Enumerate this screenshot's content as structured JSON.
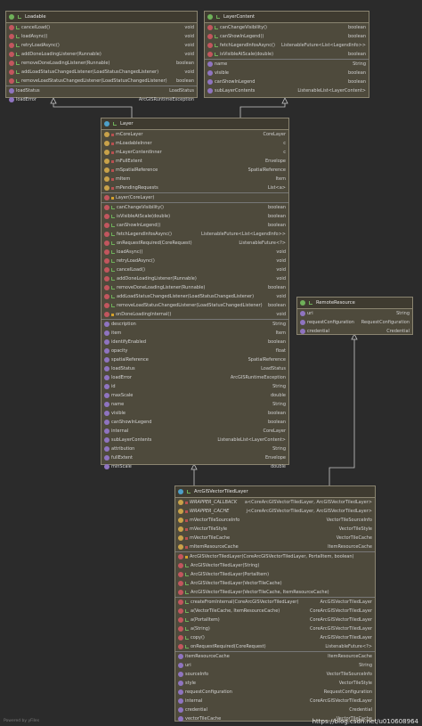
{
  "boxes": {
    "loadable": {
      "title": "Loadable",
      "kind": "interface",
      "sections": [
        [
          {
            "icon": "m",
            "vis": "pub",
            "name": "cancelLoad()",
            "type": "void"
          },
          {
            "icon": "m",
            "vis": "pub",
            "name": "loadAsync()",
            "type": "void"
          },
          {
            "icon": "m",
            "vis": "pub",
            "name": "retryLoadAsync()",
            "type": "void"
          },
          {
            "icon": "m",
            "vis": "pub",
            "name": "addDoneLoadingListener(Runnable)",
            "type": "void"
          },
          {
            "icon": "m",
            "vis": "pub",
            "name": "removeDoneLoadingListener(Runnable)",
            "type": "boolean"
          },
          {
            "icon": "m",
            "vis": "pub",
            "name": "addLoadStatusChangedListener(LoadStatusChangedListener)",
            "type": "void"
          },
          {
            "icon": "m",
            "vis": "pub",
            "name": "removeLoadStatusChangedListener(LoadStatusChangedListener)",
            "type": "boolean"
          }
        ],
        [
          {
            "icon": "p",
            "vis": "",
            "name": "loadStatus",
            "type": "LoadStatus"
          },
          {
            "icon": "p",
            "vis": "",
            "name": "loadError",
            "type": "ArcGISRuntimeException"
          }
        ]
      ]
    },
    "layerContent": {
      "title": "LayerContent",
      "kind": "interface",
      "sections": [
        [
          {
            "icon": "m",
            "vis": "pub",
            "name": "canChangeVisibility()",
            "type": "boolean"
          },
          {
            "icon": "m",
            "vis": "pub",
            "name": "canShowInLegend()",
            "type": "boolean"
          },
          {
            "icon": "m",
            "vis": "pub",
            "name": "fetchLegendInfosAsync()",
            "type": "ListenableFuture<List<LegendInfo>>"
          },
          {
            "icon": "m",
            "vis": "pub",
            "name": "isVisibleAtScale(double)",
            "type": "boolean"
          }
        ],
        [
          {
            "icon": "p",
            "vis": "",
            "name": "name",
            "type": "String"
          },
          {
            "icon": "p",
            "vis": "",
            "name": "visible",
            "type": "boolean"
          },
          {
            "icon": "p",
            "vis": "",
            "name": "canShowInLegend",
            "type": "boolean"
          },
          {
            "icon": "p",
            "vis": "",
            "name": "subLayerContents",
            "type": "ListenableList<LayerContent>"
          }
        ]
      ]
    },
    "layer": {
      "title": "Layer",
      "kind": "class",
      "sections": [
        [
          {
            "icon": "f",
            "vis": "prv",
            "name": "mCoreLayer",
            "type": "CoreLayer"
          },
          {
            "icon": "f",
            "vis": "prv",
            "name": "mLoadableInner",
            "type": "c"
          },
          {
            "icon": "f",
            "vis": "prv",
            "name": "mLayerContentInner",
            "type": "c"
          },
          {
            "icon": "f",
            "vis": "prv",
            "name": "mFullExtent",
            "type": "Envelope"
          },
          {
            "icon": "f",
            "vis": "prv",
            "name": "mSpatialReference",
            "type": "SpatialReference"
          },
          {
            "icon": "f",
            "vis": "prv",
            "name": "mItem",
            "type": "Item"
          },
          {
            "icon": "f",
            "vis": "prv",
            "name": "mPendingRequests",
            "type": "List<a>"
          }
        ],
        [
          {
            "icon": "m",
            "vis": "pro",
            "name": "Layer(CoreLayer)",
            "type": ""
          }
        ],
        [
          {
            "icon": "m",
            "vis": "pub",
            "name": "canChangeVisibility()",
            "type": "boolean"
          },
          {
            "icon": "m",
            "vis": "pub",
            "name": "isVisibleAtScale(double)",
            "type": "boolean"
          },
          {
            "icon": "m",
            "vis": "pub",
            "name": "canShowInLegend()",
            "type": "boolean"
          },
          {
            "icon": "m",
            "vis": "pub",
            "name": "fetchLegendInfosAsync()",
            "type": "ListenableFuture<List<LegendInfo>>"
          },
          {
            "icon": "m",
            "vis": "pub",
            "name": "onRequestRequired(CoreRequest)",
            "type": "ListenableFuture<?>"
          },
          {
            "icon": "m",
            "vis": "pub",
            "name": "loadAsync()",
            "type": "void"
          },
          {
            "icon": "m",
            "vis": "pub",
            "name": "retryLoadAsync()",
            "type": "void"
          },
          {
            "icon": "m",
            "vis": "pub",
            "name": "cancelLoad()",
            "type": "void"
          },
          {
            "icon": "m",
            "vis": "pub",
            "name": "addDoneLoadingListener(Runnable)",
            "type": "void"
          },
          {
            "icon": "m",
            "vis": "pub",
            "name": "removeDoneLoadingListener(Runnable)",
            "type": "boolean"
          },
          {
            "icon": "m",
            "vis": "pub",
            "name": "addLoadStatusChangedListener(LoadStatusChangedListener)",
            "type": "void"
          },
          {
            "icon": "m",
            "vis": "pub",
            "name": "removeLoadStatusChangedListener(LoadStatusChangedListener)",
            "type": "boolean"
          },
          {
            "icon": "m",
            "vis": "pro",
            "name": "onDoneLoadingInternal()",
            "type": "void"
          }
        ],
        [
          {
            "icon": "p",
            "vis": "",
            "name": "description",
            "type": "String"
          },
          {
            "icon": "p",
            "vis": "",
            "name": "item",
            "type": "Item"
          },
          {
            "icon": "p",
            "vis": "",
            "name": "identifyEnabled",
            "type": "boolean"
          },
          {
            "icon": "p",
            "vis": "",
            "name": "opacity",
            "type": "float"
          },
          {
            "icon": "p",
            "vis": "",
            "name": "spatialReference",
            "type": "SpatialReference"
          },
          {
            "icon": "p",
            "vis": "",
            "name": "loadStatus",
            "type": "LoadStatus"
          },
          {
            "icon": "p",
            "vis": "",
            "name": "loadError",
            "type": "ArcGISRuntimeException"
          },
          {
            "icon": "p",
            "vis": "",
            "name": "id",
            "type": "String"
          },
          {
            "icon": "p",
            "vis": "",
            "name": "maxScale",
            "type": "double"
          },
          {
            "icon": "p",
            "vis": "",
            "name": "name",
            "type": "String"
          },
          {
            "icon": "p",
            "vis": "",
            "name": "visible",
            "type": "boolean"
          },
          {
            "icon": "p",
            "vis": "",
            "name": "canShowInLegend",
            "type": "boolean"
          },
          {
            "icon": "p",
            "vis": "",
            "name": "internal",
            "type": "CoreLayer"
          },
          {
            "icon": "p",
            "vis": "",
            "name": "subLayerContents",
            "type": "ListenableList<LayerContent>"
          },
          {
            "icon": "p",
            "vis": "",
            "name": "attribution",
            "type": "String"
          },
          {
            "icon": "p",
            "vis": "",
            "name": "fullExtent",
            "type": "Envelope"
          },
          {
            "icon": "p",
            "vis": "",
            "name": "minScale",
            "type": "double"
          }
        ]
      ]
    },
    "remoteResource": {
      "title": "RemoteResource",
      "kind": "interface",
      "sections": [
        [
          {
            "icon": "p",
            "vis": "",
            "name": "uri",
            "type": "String"
          },
          {
            "icon": "p",
            "vis": "",
            "name": "requestConfiguration",
            "type": "RequestConfiguration"
          },
          {
            "icon": "p",
            "vis": "",
            "name": "credential",
            "type": "Credential"
          }
        ]
      ]
    },
    "vectorTiled": {
      "title": "ArcGISVectorTiledLayer",
      "kind": "class",
      "sections": [
        [
          {
            "icon": "f",
            "vis": "prv",
            "italic": true,
            "name": "WRAPPER_CALLBACK",
            "type": "a<CoreArcGISVectorTiledLayer, ArcGISVectorTiledLayer>"
          },
          {
            "icon": "f",
            "vis": "prv",
            "italic": true,
            "name": "WRAPPER_CACHE",
            "type": "j<CoreArcGISVectorTiledLayer, ArcGISVectorTiledLayer>"
          },
          {
            "icon": "f",
            "vis": "prv",
            "name": "mVectorTileSourceInfo",
            "type": "VectorTileSourceInfo"
          },
          {
            "icon": "f",
            "vis": "prv",
            "name": "mVectorTileStyle",
            "type": "VectorTileStyle"
          },
          {
            "icon": "f",
            "vis": "prv",
            "name": "mVectorTileCache",
            "type": "VectorTileCache"
          },
          {
            "icon": "f",
            "vis": "prv",
            "name": "mItemResourceCache",
            "type": "ItemResourceCache"
          }
        ],
        [
          {
            "icon": "m",
            "vis": "pro",
            "name": "ArcGISVectorTiledLayer(CoreArcGISVectorTiledLayer, PortalItem, boolean)",
            "type": ""
          },
          {
            "icon": "m",
            "vis": "pub",
            "name": "ArcGISVectorTiledLayer(String)",
            "type": ""
          },
          {
            "icon": "m",
            "vis": "pub",
            "name": "ArcGISVectorTiledLayer(PortalItem)",
            "type": ""
          },
          {
            "icon": "m",
            "vis": "pub",
            "name": "ArcGISVectorTiledLayer(VectorTileCache)",
            "type": ""
          },
          {
            "icon": "m",
            "vis": "pub",
            "name": "ArcGISVectorTiledLayer(VectorTileCache, ItemResourceCache)",
            "type": ""
          }
        ],
        [
          {
            "icon": "m",
            "vis": "pub",
            "name": "createFromInternal(CoreArcGISVectorTiledLayer)",
            "type": "ArcGISVectorTiledLayer"
          },
          {
            "icon": "m",
            "vis": "pub",
            "name": "a(VectorTileCache, ItemResourceCache)",
            "type": "CoreArcGISVectorTiledLayer"
          },
          {
            "icon": "m",
            "vis": "pub",
            "name": "a(PortalItem)",
            "type": "CoreArcGISVectorTiledLayer"
          },
          {
            "icon": "m",
            "vis": "pub",
            "name": "a(String)",
            "type": "CoreArcGISVectorTiledLayer"
          },
          {
            "icon": "m",
            "vis": "pub",
            "name": "copy()",
            "type": "ArcGISVectorTiledLayer"
          },
          {
            "icon": "m",
            "vis": "pub",
            "name": "onRequestRequired(CoreRequest)",
            "type": "ListenableFuture<?>"
          }
        ],
        [
          {
            "icon": "p",
            "vis": "",
            "name": "itemResourceCache",
            "type": "ItemResourceCache"
          },
          {
            "icon": "p",
            "vis": "",
            "name": "uri",
            "type": "String"
          },
          {
            "icon": "p",
            "vis": "",
            "name": "sourceInfo",
            "type": "VectorTileSourceInfo"
          },
          {
            "icon": "p",
            "vis": "",
            "name": "style",
            "type": "VectorTileStyle"
          },
          {
            "icon": "p",
            "vis": "",
            "name": "requestConfiguration",
            "type": "RequestConfiguration"
          },
          {
            "icon": "p",
            "vis": "",
            "name": "internal",
            "type": "CoreArcGISVectorTiledLayer"
          },
          {
            "icon": "p",
            "vis": "",
            "name": "credential",
            "type": "Credential"
          },
          {
            "icon": "p",
            "vis": "",
            "name": "vectorTileCache",
            "type": "VectorTileCache"
          }
        ]
      ]
    }
  },
  "footer": {
    "powered": "Powered by yFiles",
    "watermark": "https://blog.csdn.net/u010608964"
  },
  "colors": {
    "canvas": "#2b2b2b",
    "box_fill": "#4e4a3c",
    "box_border": "#8a8470",
    "method_icon": "#c2565e",
    "field_icon": "#c9a24a",
    "property_icon": "#8f74c0",
    "class_icon": "#4ea0c9",
    "interface_icon": "#6fb15a",
    "link_line": "#c8c8c8"
  }
}
